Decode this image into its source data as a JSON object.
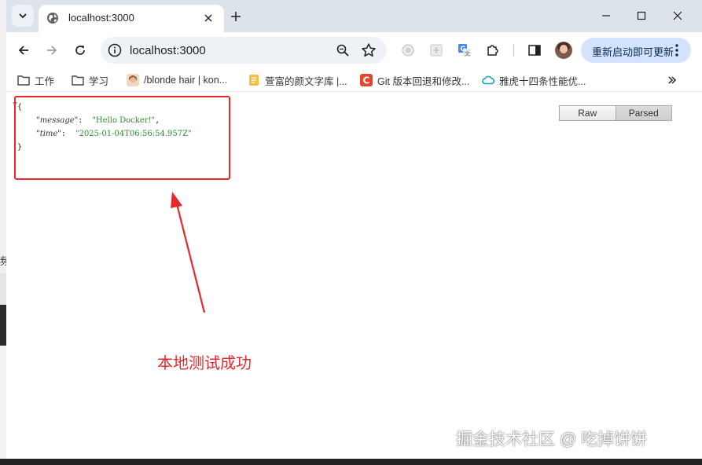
{
  "window": {
    "tab_title": "localhost:3000",
    "url": "localhost:3000",
    "update_label": "重新启动即可更新"
  },
  "bookmarks": [
    {
      "label": "工作",
      "icon": "folder-icon"
    },
    {
      "label": "学习",
      "icon": "folder-icon"
    },
    {
      "label": "/blonde hair | kon...",
      "icon": "avatar-bookmark-icon"
    },
    {
      "label": "萱富的颜文字库 |...",
      "icon": "doc-bookmark-icon"
    },
    {
      "label": "Git 版本回退和修改...",
      "icon": "csdn-icon"
    },
    {
      "label": "雅虎十四条性能优...",
      "icon": "cloud-icon"
    }
  ],
  "json_view": {
    "open_brace": "{",
    "close_brace": "}",
    "entries": [
      {
        "key": "\"message\"",
        "value": "\"Hello Docker!\"",
        "trail": ","
      },
      {
        "key": "\"time\"",
        "value": "\"2025-01-04T06:56:54.957Z\"",
        "trail": ""
      }
    ],
    "raw_label": "Raw",
    "parsed_label": "Parsed"
  },
  "annotation": "本地测试成功",
  "watermark": "掘金技术社区 @ 吃掉饼饼",
  "background_fragment": "频",
  "colors": {
    "annotation_red": "#e8282a",
    "json_string_green": "#2e8b2e",
    "update_button_bg": "#d3e3fd"
  }
}
